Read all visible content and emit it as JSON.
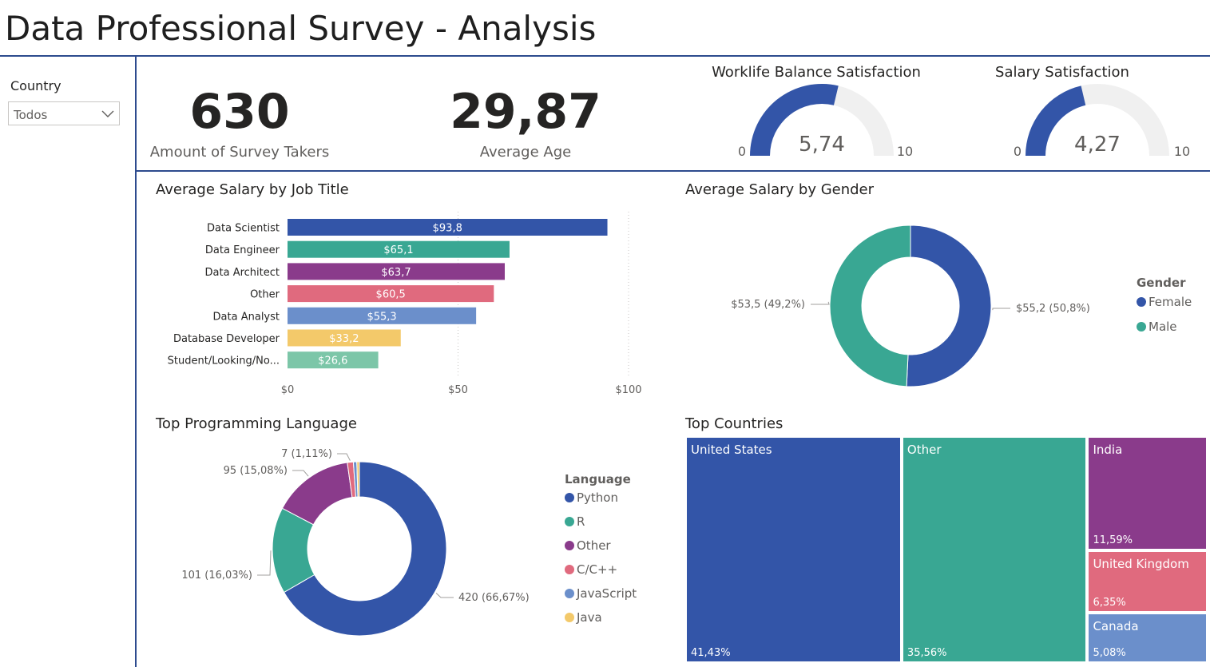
{
  "page": {
    "title": "Data Professional Survey - Analysis"
  },
  "slicer": {
    "label": "Country",
    "value": "Todos"
  },
  "kpis": {
    "survey_takers": {
      "value": "630",
      "label": "Amount of Survey Takers"
    },
    "average_age": {
      "value": "29,87",
      "label": "Average Age"
    }
  },
  "gauges": {
    "worklife": {
      "title": "Worklife Balance Satisfaction",
      "value": 5.74,
      "value_label": "5,74",
      "min_label": "0",
      "max_label": "10",
      "min": 0,
      "max": 10
    },
    "salary": {
      "title": "Salary Satisfaction",
      "value": 4.27,
      "value_label": "4,27",
      "min_label": "0",
      "max_label": "10",
      "min": 0,
      "max": 10
    }
  },
  "colors": {
    "blue": "#3355a8",
    "teal": "#39a793",
    "purple": "#8a3b8b",
    "pink": "#e06a7e",
    "lightblue": "#6b8fcb",
    "yellow": "#f3c96a",
    "mint": "#7cc6a8",
    "gauge_track": "#f0f0f0"
  },
  "chart_data": [
    {
      "id": "salary_by_job",
      "type": "bar",
      "orientation": "horizontal",
      "title": "Average Salary by Job Title",
      "categories": [
        "Data Scientist",
        "Data Engineer",
        "Data Architect",
        "Other",
        "Data Analyst",
        "Database Developer",
        "Student/Looking/No..."
      ],
      "values": [
        93.8,
        65.1,
        63.7,
        60.5,
        55.3,
        33.2,
        26.6
      ],
      "data_labels": [
        "$93,8",
        "$65,1",
        "$63,7",
        "$60,5",
        "$55,3",
        "$33,2",
        "$26,6"
      ],
      "colors": [
        "#3355a8",
        "#39a793",
        "#8a3b8b",
        "#e06a7e",
        "#6b8fcb",
        "#f3c96a",
        "#7cc6a8"
      ],
      "xlim": [
        0,
        100
      ],
      "x_ticks": [
        0,
        50,
        100
      ],
      "x_tick_labels": [
        "$0",
        "$50",
        "$100"
      ],
      "grid": true
    },
    {
      "id": "salary_by_gender",
      "type": "pie",
      "donut": true,
      "title": "Average Salary by Gender",
      "legend_title": "Gender",
      "legend_position": "right",
      "categories": [
        "Female",
        "Male"
      ],
      "values": [
        55.2,
        53.5
      ],
      "data_labels": [
        "$55,2 (50,8%)",
        "$53,5 (49,2%)"
      ],
      "colors": [
        "#3355a8",
        "#39a793"
      ]
    },
    {
      "id": "top_language",
      "type": "pie",
      "donut": true,
      "title": "Top Programming Language",
      "legend_title": "Language",
      "legend_position": "right",
      "categories": [
        "Python",
        "R",
        "Other",
        "C/C++",
        "JavaScript",
        "Java"
      ],
      "values": [
        420,
        101,
        95,
        7,
        4,
        3
      ],
      "data_labels": [
        "420 (66,67%)",
        "101 (16,03%)",
        "95 (15,08%)",
        "7 (1,11%)",
        "",
        ""
      ],
      "colors": [
        "#3355a8",
        "#39a793",
        "#8a3b8b",
        "#e06a7e",
        "#6b8fcb",
        "#f3c96a"
      ]
    },
    {
      "id": "top_countries",
      "type": "treemap",
      "title": "Top Countries",
      "categories": [
        "United States",
        "Other",
        "India",
        "United Kingdom",
        "Canada"
      ],
      "values": [
        41.43,
        35.56,
        11.59,
        6.35,
        5.08
      ],
      "data_labels": [
        "41,43%",
        "35,56%",
        "11,59%",
        "6,35%",
        "5,08%"
      ],
      "colors": [
        "#3355a8",
        "#39a793",
        "#8a3b8b",
        "#e06a7e",
        "#6b8fcb"
      ]
    }
  ]
}
